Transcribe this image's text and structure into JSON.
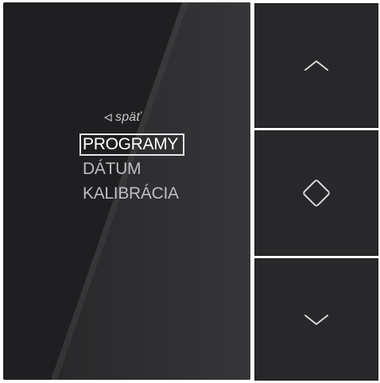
{
  "menu": {
    "back_label": "späť",
    "items": [
      {
        "label": "PROGRAMY",
        "selected": true
      },
      {
        "label": "DÁTUM",
        "selected": false
      },
      {
        "label": "KALIBRÁCIA",
        "selected": false
      }
    ]
  },
  "buttons": {
    "up_icon": "chevron-up-icon",
    "ok_icon": "diamond-select-icon",
    "down_icon": "chevron-down-icon"
  },
  "colors": {
    "panel": "#1f1f21",
    "button": "#28282a",
    "text": "#e4e4e6",
    "selection_border": "#e8e8ea"
  }
}
